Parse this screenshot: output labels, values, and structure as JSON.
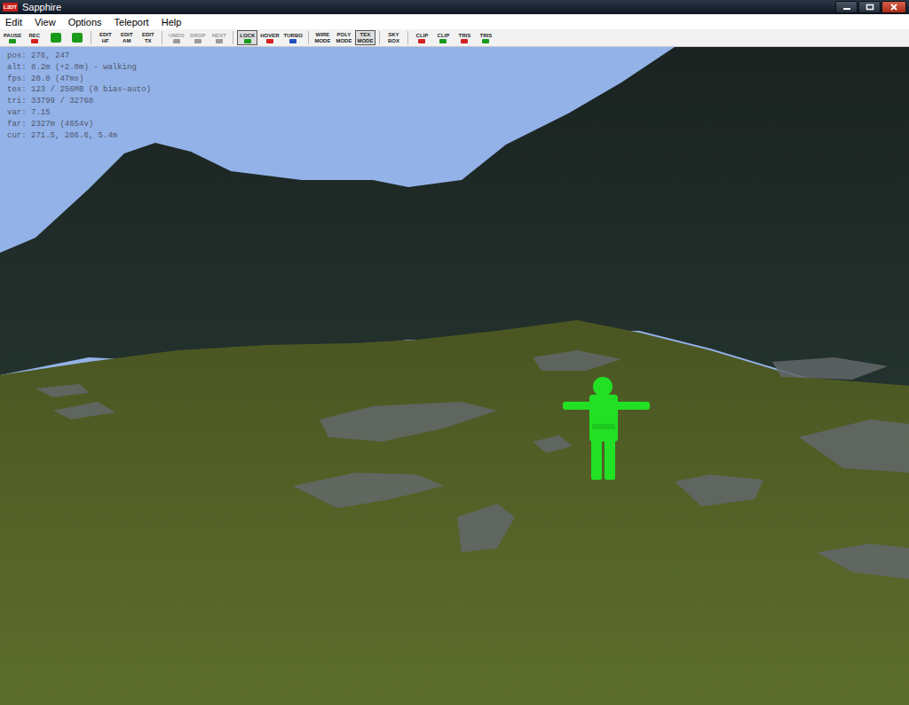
{
  "window": {
    "title": "Sapphire",
    "icon_text": "L3DT"
  },
  "menu": [
    "Edit",
    "View",
    "Options",
    "Teleport",
    "Help"
  ],
  "toolbar": [
    [
      {
        "lines": [
          "PAUSE"
        ],
        "kind": "label-icon",
        "color": "#1a9a1a",
        "selected": false,
        "disabled": false
      },
      {
        "lines": [
          "REC"
        ],
        "kind": "label-icon",
        "color": "#d42020",
        "selected": false,
        "disabled": false
      },
      {
        "lines": [],
        "kind": "icon",
        "color": "#1a9a1a",
        "selected": false,
        "disabled": false
      },
      {
        "lines": [],
        "kind": "icon",
        "color": "#1a9a1a",
        "selected": false,
        "disabled": false
      }
    ],
    [
      {
        "lines": [
          "EDIT",
          "HF"
        ],
        "kind": "text",
        "color": "#222222",
        "selected": false,
        "disabled": false
      },
      {
        "lines": [
          "EDIT",
          "AM"
        ],
        "kind": "text",
        "color": "#222222",
        "selected": false,
        "disabled": false
      },
      {
        "lines": [
          "EDIT",
          "TX"
        ],
        "kind": "text",
        "color": "#222222",
        "selected": false,
        "disabled": false
      }
    ],
    [
      {
        "lines": [
          "UNDO"
        ],
        "kind": "label-icon",
        "color": "#9a9a9a",
        "selected": false,
        "disabled": true
      },
      {
        "lines": [
          "DROP"
        ],
        "kind": "label-icon",
        "color": "#9a9a9a",
        "selected": false,
        "disabled": true
      },
      {
        "lines": [
          "NEXT"
        ],
        "kind": "label-icon",
        "color": "#9a9a9a",
        "selected": false,
        "disabled": true
      }
    ],
    [
      {
        "lines": [
          "LOCK"
        ],
        "kind": "label-icon",
        "color": "#1a9a1a",
        "selected": true,
        "disabled": false
      },
      {
        "lines": [
          "HOVER"
        ],
        "kind": "label-icon",
        "color": "#d42020",
        "selected": false,
        "disabled": false
      },
      {
        "lines": [
          "TURBO"
        ],
        "kind": "label-icon",
        "color": "#2050c0",
        "selected": false,
        "disabled": false
      }
    ],
    [
      {
        "lines": [
          "WIRE",
          "MODE"
        ],
        "kind": "text",
        "color": "#222222",
        "selected": false,
        "disabled": false
      },
      {
        "lines": [
          "POLY",
          "MODE"
        ],
        "kind": "text",
        "color": "#222222",
        "selected": false,
        "disabled": false
      },
      {
        "lines": [
          "TEX",
          "MODE"
        ],
        "kind": "text",
        "color": "#222222",
        "selected": true,
        "disabled": false
      }
    ],
    [
      {
        "lines": [
          "SKY",
          "BOX"
        ],
        "kind": "text",
        "color": "#222222",
        "selected": false,
        "disabled": false
      }
    ],
    [
      {
        "lines": [
          "CLIP"
        ],
        "kind": "label-icon",
        "color": "#d42020",
        "selected": false,
        "disabled": false
      },
      {
        "lines": [
          "CLIP"
        ],
        "kind": "label-icon",
        "color": "#1a9a1a",
        "selected": false,
        "disabled": false
      },
      {
        "lines": [
          "TRIS"
        ],
        "kind": "label-icon",
        "color": "#d42020",
        "selected": false,
        "disabled": false
      },
      {
        "lines": [
          "TRIS"
        ],
        "kind": "label-icon",
        "color": "#1a9a1a",
        "selected": false,
        "disabled": false
      }
    ]
  ],
  "stats": [
    "pos: 276, 247",
    "alt: 8.2m (+2.0m) - walking",
    "fps: 20.0 (47ms)",
    "tex: 123 / 256MB (0 bias-auto)",
    "tri: 33799 / 32768",
    "var: 7.15",
    "far: 2327m (4654v)",
    "cur: 271.5, 286.6, 5.4m"
  ]
}
